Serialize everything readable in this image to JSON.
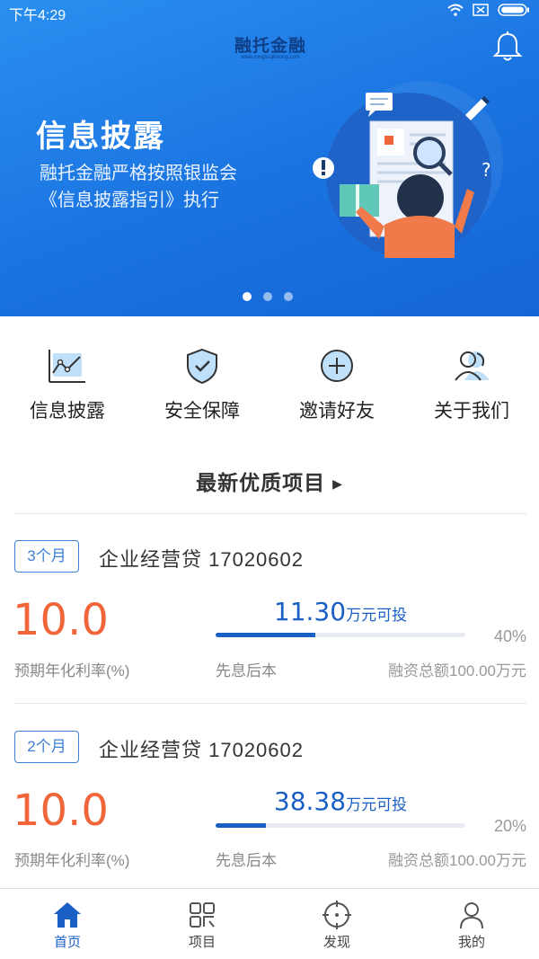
{
  "status": {
    "time": "下午4:29"
  },
  "header": {
    "logo_text": "融托金融",
    "logo_sub": "www.rongtuojinrong.com"
  },
  "banner": {
    "title": "信息披露",
    "line1": "融托金融严格按照银监会",
    "line2": "《信息披露指引》执行",
    "dot_count": 3,
    "active_dot": 0
  },
  "quick_menu": [
    {
      "label": "信息披露",
      "icon": "chart-icon"
    },
    {
      "label": "安全保障",
      "icon": "shield-check-icon"
    },
    {
      "label": "邀请好友",
      "icon": "plus-circle-icon"
    },
    {
      "label": "关于我们",
      "icon": "people-icon"
    }
  ],
  "section": {
    "title": "最新优质项目"
  },
  "projects": [
    {
      "term": "3个月",
      "name": "企业经营贷 17020602",
      "rate": "10.0",
      "rate_label": "预期年化利率(%)",
      "available_amount": "11.30",
      "available_unit": "万元可投",
      "progress": 0.4,
      "progress_text": "40%",
      "repay_method": "先息后本",
      "total": "融资总额100.00万元"
    },
    {
      "term": "2个月",
      "name": "企业经营贷 17020602",
      "rate": "10.0",
      "rate_label": "预期年化利率(%)",
      "available_amount": "38.38",
      "available_unit": "万元可投",
      "progress": 0.2,
      "progress_text": "20%",
      "repay_method": "先息后本",
      "total": "融资总额100.00万元"
    }
  ],
  "tabs": [
    {
      "label": "首页",
      "icon": "home-icon",
      "active": true
    },
    {
      "label": "项目",
      "icon": "grid-icon",
      "active": false
    },
    {
      "label": "发现",
      "icon": "compass-icon",
      "active": false
    },
    {
      "label": "我的",
      "icon": "user-icon",
      "active": false
    }
  ],
  "colors": {
    "primary": "#1a5fc4",
    "rate": "#f0663a",
    "banner": "#1a73e0"
  }
}
